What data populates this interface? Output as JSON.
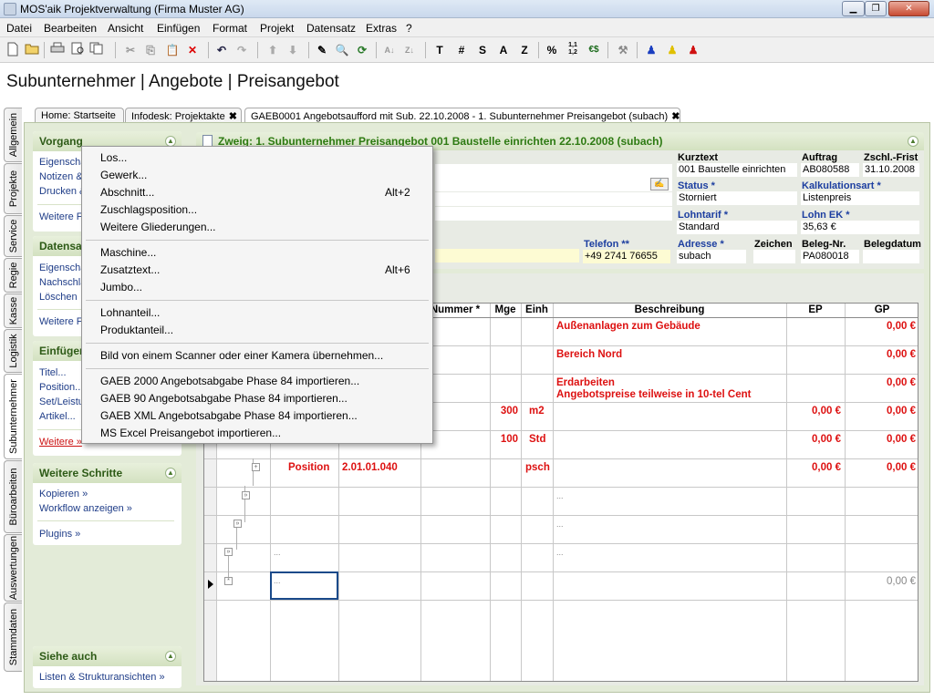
{
  "window": {
    "title": "MOS'aik Projektverwaltung (Firma Muster AG)"
  },
  "menu": [
    "Datei",
    "Bearbeiten",
    "Ansicht",
    "Einfügen",
    "Format",
    "Projekt",
    "Datensatz",
    "Extras",
    "?"
  ],
  "toolbar_text": {
    "t": "T",
    "hash": "#",
    "s": "S",
    "a": "A",
    "z": "Z",
    "percent": "%",
    "num": "1,1\n1,2",
    "eur": "€$"
  },
  "page_title": "Subunternehmer | Angebote | Preisangebot",
  "vertical_tabs": [
    "Allgemein",
    "Projekte",
    "Service",
    "Regie",
    "Kasse",
    "Logistik",
    "Subunternehmer",
    "Büroarbeiten",
    "Auswertungen",
    "Stammdaten"
  ],
  "doc_tabs": [
    "Home: Startseite",
    "Infodesk: Projektakte",
    "GAEB0001 Angebotsaufford mit Sub. 22.10.2008 - 1. Subunternehmer Preisangebot (subach)"
  ],
  "close_glyph": "✖",
  "sidebar": {
    "vorgang": {
      "title": "Vorgang",
      "links": [
        "Eigenscha",
        "Notizen &",
        "Drucken &"
      ],
      "more": "Weitere F"
    },
    "datensatz": {
      "title": "Datensa",
      "links": [
        "Eigenscha",
        "Nachschla",
        "Löschen"
      ],
      "more": "Weitere F"
    },
    "einfuegen": {
      "title": "Einfügen",
      "links": [
        "Titel...",
        "Position...",
        "Set/Leistu",
        "Artikel..."
      ],
      "more": "Weitere »"
    },
    "weitere_schritte": {
      "title": "Weitere Schritte",
      "links": [
        "Kopieren »",
        "Workflow anzeigen »"
      ],
      "plugins": "Plugins »"
    },
    "siehe_auch": {
      "title": "Siehe auch",
      "links": [
        "Listen & Strukturansichten »"
      ]
    }
  },
  "dropdown": {
    "group1": [
      {
        "label": "Los..."
      },
      {
        "label": "Gewerk..."
      },
      {
        "label": "Abschnitt...",
        "shortcut": "Alt+2"
      },
      {
        "label": "Zuschlagsposition..."
      },
      {
        "label": "Weitere Gliederungen..."
      }
    ],
    "group2": [
      {
        "label": "Maschine..."
      },
      {
        "label": "Zusatztext...",
        "shortcut": "Alt+6"
      },
      {
        "label": "Jumbo..."
      }
    ],
    "group3": [
      {
        "label": "Lohnanteil..."
      },
      {
        "label": "Produktanteil..."
      }
    ],
    "group4": [
      {
        "label": "Bild von einem Scanner oder einer Kamera übernehmen..."
      }
    ],
    "group5": [
      {
        "label": "GAEB 2000 Angebotsabgabe Phase 84 importieren..."
      },
      {
        "label": "GAEB 90 Angebotsabgabe Phase 84 importieren..."
      },
      {
        "label": "GAEB XML Angebotsabgabe Phase 84 importieren..."
      },
      {
        "label": "MS Excel Preisangebot importieren..."
      }
    ]
  },
  "branch": {
    "title": "Zweig: 1. Subunternehmer Preisangebot 001 Baustelle einrichten 22.10.2008 (subach)"
  },
  "fields": {
    "kurztext_label": "Kurztext",
    "kurztext": "001 Baustelle einrichten",
    "auftrag_label": "Auftrag",
    "auftrag": "AB080588",
    "zschl_label": "Zschl.-Frist",
    "zschl": "31.10.2008",
    "status_label": "Status *",
    "status": "Storniert",
    "kalk_label": "Kalkulationsart *",
    "kalk": "Listenpreis",
    "lohntarif_label": "Lohntarif *",
    "lohntarif": "Standard",
    "lohnek_label": "Lohn EK *",
    "lohnek": "35,63 €",
    "telefon_label": "Telefon **",
    "telefon": "+49 2741 76655",
    "adresse_label": "Adresse *",
    "adresse": "subach",
    "zeichen_label": "Zeichen",
    "zeichen": "",
    "belegnr_label": "Beleg-Nr.",
    "belegnr": "PA080018",
    "belegdatum_label": "Belegdatum",
    "belegdatum": ""
  },
  "grid": {
    "headers": {
      "nummer": "Nummer *",
      "mge": "Mge",
      "einh": "Einh",
      "beschreibung": "Beschreibung",
      "ep": "EP",
      "gp": "GP"
    },
    "rows": [
      {
        "typ": "",
        "nummer": "",
        "mge": "",
        "einh": "",
        "beschreibung": "Außenanlagen zum Gebäude",
        "ep": "",
        "gp": "0,00 €"
      },
      {
        "typ": "",
        "nummer": "",
        "mge": "",
        "einh": "",
        "beschreibung": "Bereich Nord",
        "ep": "",
        "gp": "0,00 €"
      },
      {
        "typ": "",
        "nummer": "",
        "mge": "",
        "einh": "",
        "beschreibung": "Erdarbeiten",
        "beschreibung2": "Angebotspreise teilweise in 10-tel Cent",
        "ep": "",
        "gp": "0,00 €"
      },
      {
        "typ": "",
        "nummer": "",
        "mge": "300",
        "einh": "m2",
        "beschreibung": "",
        "ep": "0,00 €",
        "gp": "0,00 €"
      },
      {
        "typ": "",
        "nummer": "",
        "mge": "100",
        "einh": "Std",
        "beschreibung": "",
        "ep": "0,00 €",
        "gp": "0,00 €"
      },
      {
        "typ": "Position",
        "nummer": "2.01.01.040",
        "mge": "",
        "einh": "psch",
        "beschreibung": "",
        "ep": "0,00 €",
        "gp": "0,00 €"
      },
      {
        "typ": "",
        "nummer": "",
        "mge": "",
        "einh": "",
        "beschreibung": "...",
        "ep": "",
        "gp": ""
      },
      {
        "typ": "",
        "nummer": "",
        "mge": "",
        "einh": "",
        "beschreibung": "...",
        "ep": "",
        "gp": ""
      },
      {
        "typ": "...",
        "nummer": "",
        "mge": "",
        "einh": "",
        "beschreibung": "...",
        "ep": "",
        "gp": ""
      },
      {
        "typ": "...",
        "nummer": "",
        "mge": "",
        "einh": "",
        "beschreibung": "",
        "ep": "",
        "gp": "0,00 €"
      }
    ]
  }
}
